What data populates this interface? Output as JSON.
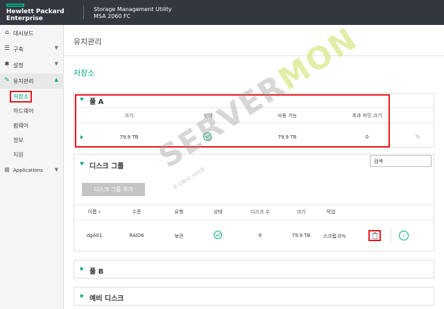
{
  "header": {
    "brand_line1": "Hewlett Packard",
    "brand_line2": "Enterprise",
    "app_line1": "Storage Management Utility",
    "app_line2": "MSA 2060 FC"
  },
  "sidebar": {
    "items": [
      {
        "label": "대시보드",
        "icon": "home-icon"
      },
      {
        "label": "구축",
        "icon": "database-icon"
      },
      {
        "label": "설정",
        "icon": "gear-icon"
      },
      {
        "label": "유지관리",
        "icon": "wrench-icon"
      }
    ],
    "subitems": [
      "저장소",
      "하드웨어",
      "펌웨어",
      "정보",
      "지원"
    ],
    "applications": "Applications"
  },
  "main": {
    "page_title": "유지관리",
    "section_title": "저장소",
    "pool_a": {
      "title": "풀 A",
      "headers": [
        "크기",
        "상태",
        "사용 가능",
        "초과 커밋 크기"
      ],
      "row": {
        "size": "79.9 TB",
        "available": "79.9 TB",
        "overcommit": "0"
      }
    },
    "disk_group": {
      "title": "디스크 그룹",
      "search_label": "검색",
      "add_button": "디스크 그룹 추가",
      "headers": [
        "이름",
        "수준",
        "유형",
        "상태",
        "디스크 수",
        "크기",
        "작업"
      ],
      "row": {
        "name": "dgA01",
        "level": "RAID6",
        "type": "보관",
        "disks": "6",
        "size": "79.9 TB",
        "job": "스크럽:0%"
      }
    },
    "pool_b": {
      "title": "풀 B"
    },
    "spare": {
      "title": "예비 디스크"
    }
  },
  "watermark": {
    "text_a": "SERVER",
    "text_b": "MON",
    "small": "주식회사 서버몬"
  },
  "colors": {
    "accent": "#01a982",
    "topbar": "#333840",
    "highlight": "#e3161b"
  }
}
